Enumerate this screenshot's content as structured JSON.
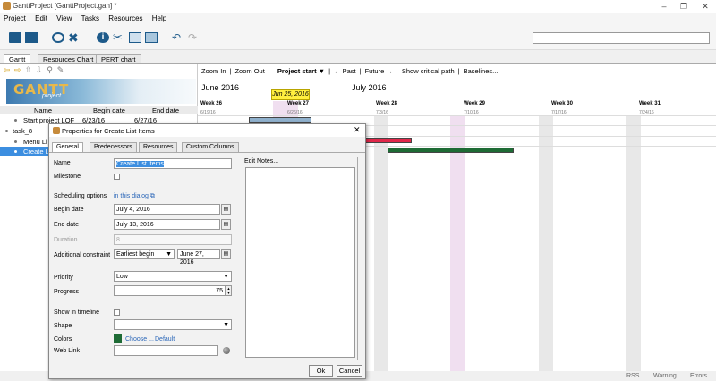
{
  "window": {
    "title": "GanttProject [GanttProject.gan] *",
    "min": "–",
    "max": "❐",
    "close": "✕"
  },
  "menu": [
    "Project",
    "Edit",
    "View",
    "Tasks",
    "Resources",
    "Help"
  ],
  "tabs": [
    "Gantt",
    "Resources Chart",
    "PERT chart"
  ],
  "logo": {
    "text": "GANTT",
    "sub": "project"
  },
  "grid": {
    "headers": [
      "Name",
      "Begin date",
      "End date"
    ],
    "rows": [
      {
        "name": "Start project LOF",
        "begin": "6/23/16",
        "end": "6/27/16"
      },
      {
        "name": "task_8",
        "begin": "",
        "end": ""
      },
      {
        "name": "Menu Li",
        "begin": "",
        "end": ""
      },
      {
        "name": "Create L",
        "begin": "",
        "end": ""
      }
    ]
  },
  "chart": {
    "toolbar": [
      "Zoom In",
      "|",
      "Zoom Out",
      "Project start ▼",
      "|",
      "← Past",
      "|",
      "Future →",
      "Show critical path",
      "|",
      "Baselines..."
    ],
    "months": [
      "June 2016",
      "July 2016"
    ],
    "today": "Jun 25, 2016",
    "weeks": [
      {
        "label": "Week 26",
        "date": "6/19/16"
      },
      {
        "label": "Week 27",
        "date": "6/26/16"
      },
      {
        "label": "Week 28",
        "date": "7/3/16"
      },
      {
        "label": "Week 29",
        "date": "7/10/16"
      },
      {
        "label": "Week 30",
        "date": "7/17/16"
      },
      {
        "label": "Week 31",
        "date": "7/24/16"
      }
    ]
  },
  "status": [
    "RSS",
    "Warning",
    "Errors"
  ],
  "dialog": {
    "title": "Properties for Create List Items",
    "close": "✕",
    "tabs": [
      "General",
      "Predecessors",
      "Resources",
      "Custom Columns"
    ],
    "name_label": "Name",
    "name_value": "Create List Items",
    "milestone_label": "Milestone",
    "scheduling_label": "Scheduling options",
    "scheduling_link": "in this dialog",
    "begin_label": "Begin date",
    "begin_value": "July 4, 2016",
    "end_label": "End date",
    "end_value": "July 13, 2016",
    "duration_label": "Duration",
    "duration_value": "8",
    "constraint_label": "Additional constraint",
    "constraint_value": "Earliest begin",
    "constraint_date": "June 27, 2016",
    "priority_label": "Priority",
    "priority_value": "Low",
    "progress_label": "Progress",
    "progress_value": "75",
    "timeline_label": "Show in timeline",
    "shape_label": "Shape",
    "shape_value": "",
    "colors_label": "Colors",
    "color_choose": "Choose ...",
    "color_default": "Default",
    "color_swatch": "#1e6b35",
    "weblink_label": "Web Link",
    "weblink_value": "",
    "notes_label": "Edit Notes...",
    "ok": "Ok",
    "cancel": "Cancel"
  }
}
